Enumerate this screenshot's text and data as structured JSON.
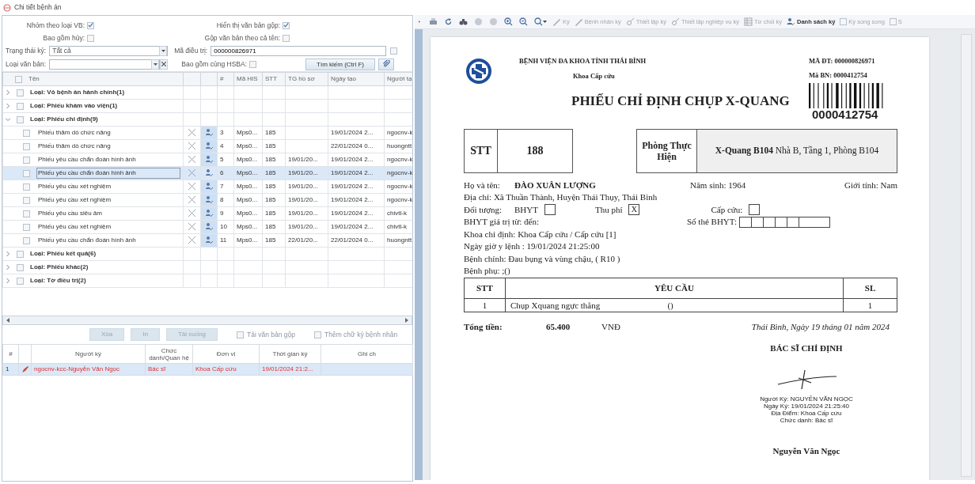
{
  "window": {
    "title": "Chi tiết bệnh án"
  },
  "filters": {
    "group_by_type": {
      "label": "Nhóm theo loại VB:",
      "checked": true
    },
    "show_merged": {
      "label": "Hiển thị văn bản gộp:",
      "checked": true
    },
    "include_cancelled": {
      "label": "Bao gồm hủy:",
      "checked": false
    },
    "merge_by_name": {
      "label": "Gộp văn bản theo cả tên:",
      "checked": false
    },
    "sign_status": {
      "label": "Trạng thái ký:",
      "value": "Tất cả"
    },
    "treatment_code": {
      "label": "Mã điều trị:",
      "value": "000000826971"
    },
    "extra_option": {
      "checked": false
    },
    "doc_type": {
      "label": "Loại văn bản:"
    },
    "include_hsba": {
      "label": "Bao gồm cùng HSBA:",
      "checked": false
    },
    "search_button": {
      "label": "Tìm kiếm (Ctrl F)"
    }
  },
  "tree": {
    "header_checked": false,
    "columns": {
      "name": "Tên",
      "num": "#",
      "ma_his": "Mã HIS",
      "stt": "STT",
      "tg": "TG hồ sơ",
      "created": "Ngày tạo",
      "creator": "Người tạ"
    },
    "groups": [
      {
        "label": "Loại: Vỏ bệnh án hành chính(1)",
        "expanded": false,
        "checked": false
      },
      {
        "label": "Loại: Phiếu khám vào viện(1)",
        "expanded": false,
        "checked": false
      },
      {
        "label": "Loại: Phiếu chỉ định(9)",
        "expanded": true,
        "checked": false,
        "children": [
          {
            "name": "Phiếu thăm dò chức năng",
            "num": "3",
            "ma_his": "Mps0...",
            "stt": "185",
            "created": "19/01/2024 2...",
            "creator": "ngocnv-k",
            "checked": false,
            "selected": false
          },
          {
            "name": "Phiếu thăm dò chức năng",
            "num": "4",
            "ma_his": "Mps0...",
            "stt": "185",
            "created": "22/01/2024 0...",
            "creator": "huongntt",
            "checked": false,
            "selected": false
          },
          {
            "name": "Phiếu yêu cầu chẩn đoán hình ảnh",
            "num": "5",
            "ma_his": "Mps0...",
            "stt": "185",
            "tg": "19/01/20...",
            "created": "19/01/2024 2...",
            "creator": "ngocnv-k",
            "checked": false,
            "selected": false
          },
          {
            "name": "Phiếu yêu cầu chẩn đoán hình ảnh",
            "num": "6",
            "ma_his": "Mps0...",
            "stt": "185",
            "tg": "19/01/20...",
            "created": "19/01/2024 2...",
            "creator": "ngocnv-k",
            "checked": false,
            "selected": true
          },
          {
            "name": "Phiếu yêu cầu xét nghiệm",
            "num": "7",
            "ma_his": "Mps0...",
            "stt": "185",
            "tg": "19/01/20...",
            "created": "19/01/2024 2...",
            "creator": "ngocnv-k",
            "checked": false,
            "selected": false
          },
          {
            "name": "Phiếu yêu cầu xét nghiệm",
            "num": "8",
            "ma_his": "Mps0...",
            "stt": "185",
            "tg": "19/01/20...",
            "created": "19/01/2024 2...",
            "creator": "ngocnv-k",
            "checked": false,
            "selected": false
          },
          {
            "name": "Phiếu yêu cầu siêu âm",
            "num": "9",
            "ma_his": "Mps0...",
            "stt": "185",
            "tg": "19/01/20...",
            "created": "19/01/2024 2...",
            "creator": "chivtl-k",
            "checked": false,
            "selected": false
          },
          {
            "name": "Phiếu yêu cầu xét nghiệm",
            "num": "10",
            "ma_his": "Mps0...",
            "stt": "185",
            "tg": "19/01/20...",
            "created": "19/01/2024 2...",
            "creator": "chivtl-k",
            "checked": false,
            "selected": false
          },
          {
            "name": "Phiếu yêu cầu chẩn đoán hình ảnh",
            "num": "11",
            "ma_his": "Mps0...",
            "stt": "185",
            "tg": "22/01/20...",
            "created": "22/01/2024 0...",
            "creator": "huongntt",
            "checked": false,
            "selected": false
          }
        ]
      },
      {
        "label": "Loại: Phiếu kết quả(6)",
        "expanded": false,
        "checked": false
      },
      {
        "label": "Loại: Phiếu khác(2)",
        "expanded": false,
        "checked": false
      },
      {
        "label": "Loại: Tờ điều trị(2)",
        "expanded": false,
        "checked": false
      }
    ]
  },
  "actions": {
    "buttons": [
      {
        "label": "Xóa",
        "disabled": true
      },
      {
        "label": "In",
        "disabled": true
      },
      {
        "label": "Tải xuống",
        "disabled": true
      }
    ],
    "checkboxes": [
      {
        "label": "Tải văn bản gộp",
        "checked": false,
        "disabled": true
      },
      {
        "label": "Thêm chữ ký bệnh nhân",
        "checked": false,
        "disabled": true
      }
    ]
  },
  "signers": {
    "columns": {
      "num": "#",
      "signer": "Người ký",
      "title": "Chức danh/Quan hệ",
      "unit": "Đơn vị",
      "time": "Thời gian ký",
      "note": "Ghi ch"
    },
    "rows": [
      {
        "num": "1",
        "signer": "ngocnv-kcc-Nguyễn Văn Ngọc",
        "title": "Bác sĩ",
        "unit": "Khoa Cấp cứu",
        "time": "19/01/2024 21:2...",
        "selected": true
      }
    ]
  },
  "toolbar": {
    "items": [
      {
        "kind": "button",
        "label": "Ký",
        "disabled": true
      },
      {
        "kind": "button",
        "label": "Bệnh nhân ký",
        "disabled": true
      },
      {
        "kind": "button",
        "label": "Thiết lập ký",
        "disabled": true
      },
      {
        "kind": "button",
        "label": "Thiết lập nghiệp vụ ký",
        "disabled": true
      },
      {
        "kind": "button",
        "label": "Từ chối ký",
        "disabled": true
      },
      {
        "kind": "button",
        "label": "Danh sách ký",
        "disabled": false
      },
      {
        "kind": "checkbox",
        "label": "Ký song song",
        "disabled": true,
        "checked": false
      },
      {
        "kind": "checkbox",
        "label": "S",
        "disabled": true,
        "checked": false
      }
    ]
  },
  "document": {
    "hospital": "BỆNH VIỆN ĐA KHOA TỈNH THÁI BÌNH",
    "department": "Khoa Cấp cứu",
    "ma_dt": "MÃ ĐT: 000000826971",
    "ma_bn": "Mã BN: 0000412754",
    "barcode_number": "0000412754",
    "title": "PHIẾU CHỈ ĐỊNH CHỤP X-QUANG",
    "stt_label": "STT",
    "stt_value": "188",
    "room_label": "Phòng Thực Hiện",
    "room_value": "**X-Quang B104** Nhà B, Tầng 1, Phòng B104",
    "name_label": "Họ và tên:",
    "name_value": "ĐÀO XUÂN LƯỢNG",
    "birth": "Năm sinh: 1964",
    "gender": "Giới tính: Nam",
    "address": "Địa chỉ: Xã  Thuần Thành, Huyện Thái Thụy, Thái Bình",
    "object_label": "Đối tượng:",
    "options": [
      {
        "label": "BHYT",
        "checked": false
      },
      {
        "label": "Thu phí",
        "checked": true,
        "mark": "X"
      },
      {
        "label": "Cấp cứu:",
        "checked": false
      }
    ],
    "bhyt_validity": "BHYT giá trị từ:  đến:",
    "card_label": "Số thẻ BHYT:",
    "lines": [
      "Khoa chỉ định: Khoa Cấp cứu /  Cấp cứu [1]",
      "Ngày giờ y lệnh : 19/01/2024 21:25:00",
      "Bệnh chính: Đau bụng và vùng chậu, ( R10 )",
      "Bệnh phụ: ;()"
    ],
    "table": {
      "columns": [
        "STT",
        "YÊU CẦU",
        "SL"
      ],
      "rows": [
        {
          "stt": "1",
          "request": "Chụp Xquang ngực thẳng",
          "note": "()",
          "qty": "1"
        }
      ]
    },
    "total_label": "Tổng tiền:",
    "total": "65.400",
    "currency": "VNĐ",
    "place_date": "Thái Bình, Ngày 19 tháng 01 năm 2024",
    "signer_title": "BÁC SĨ CHỈ ĐỊNH",
    "stamp": [
      "Người Ký: NGUYỄN VĂN NGỌC",
      "Ngày Ký: 19/01/2024 21:25:40",
      "Địa Điểm: Khoa Cấp cứu",
      "Chức danh: Bác sĩ"
    ],
    "signer_name": "Nguyễn Văn Ngọc"
  }
}
